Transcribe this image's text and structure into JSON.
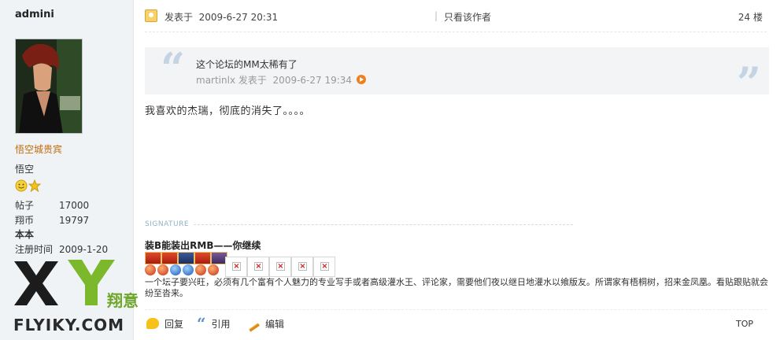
{
  "author": {
    "name": "admini",
    "group": "悟空城贵宾",
    "nickname": "悟空",
    "stats": [
      {
        "label": "帖子",
        "value": "17000"
      },
      {
        "label": "翔币",
        "value": "19797"
      },
      {
        "label": "本本",
        "value": ""
      },
      {
        "label": "注册时间",
        "value": "2009-1-20"
      }
    ]
  },
  "post": {
    "posted_label": "发表于",
    "posted_time": "2009-6-27 20:31",
    "separator": "|",
    "only_author": "只看该作者",
    "floor": "24 楼",
    "quote": {
      "text": "这个论坛的MM太稀有了",
      "author": "martinlx",
      "posted_label": "发表于",
      "time": "2009-6-27 19:34"
    },
    "content": "我喜欢的杰瑞，彻底的消失了。。。。"
  },
  "signature": {
    "label": "SIGNATURE",
    "title": "装B能装出RMB——你继续",
    "text": "一个坛子要兴旺，必须有几个富有个人魅力的专业写手或者高级灌水王、评论家，需要他们夜以继日地灌水以飨版友。所谓家有梧桐树，招来金凤凰。看贴跟贴就会纷至沓来。"
  },
  "actions": {
    "reply": "回复",
    "quote": "引用",
    "edit": "编辑",
    "top": "TOP"
  },
  "watermark": {
    "site": "FLYIKY.COM",
    "cn": "翔意",
    "letters": "XY"
  },
  "colors": {
    "sidebar_bg": "#f0f3f5",
    "group": "#c26a0a",
    "quote_bg": "#f2f4f6",
    "watermark_green": "#6fa72c"
  }
}
